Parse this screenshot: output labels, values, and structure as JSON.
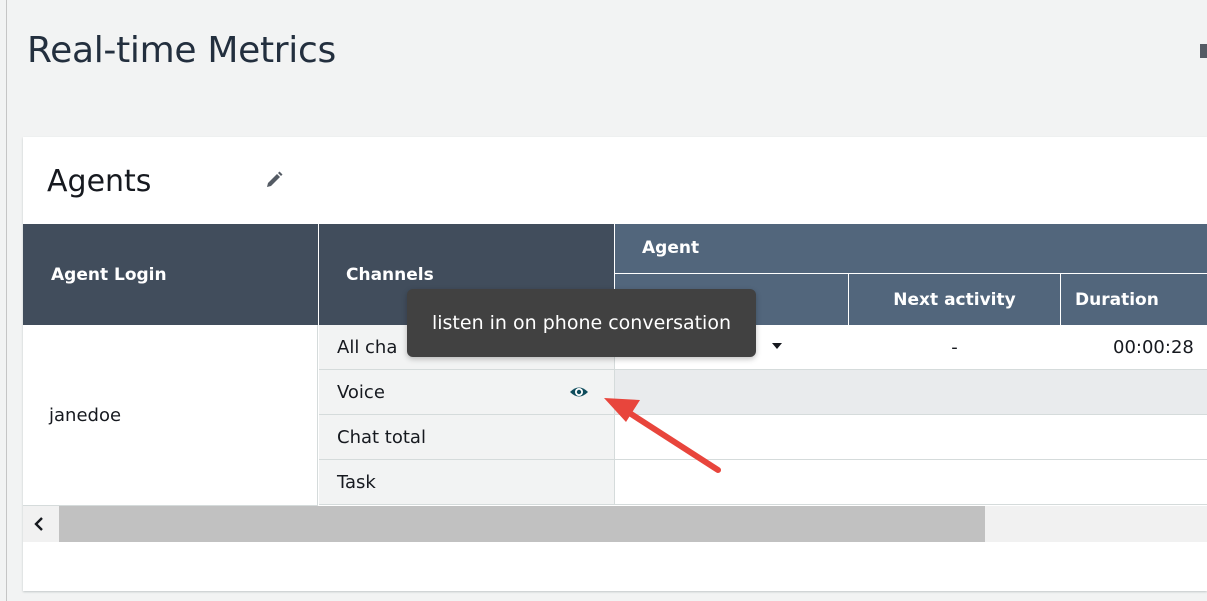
{
  "page": {
    "title": "Real-time Metrics"
  },
  "card": {
    "title": "Agents",
    "edit_icon": "pencil-icon"
  },
  "table": {
    "headers": {
      "agent_login": "Agent Login",
      "channels": "Channels",
      "agent_group": "Agent",
      "next_activity": "Next activity",
      "duration": "Duration"
    },
    "agent": "janedoe",
    "rows": [
      {
        "channel": "All cha",
        "next_activity": "-",
        "duration": "00:00:28"
      },
      {
        "channel": "Voice",
        "icon": "eye-icon"
      },
      {
        "channel": "Chat total"
      },
      {
        "channel": "Task"
      }
    ]
  },
  "tooltip": {
    "text": "listen in on phone conversation"
  },
  "colors": {
    "header_dark": "#414d5c",
    "header_mid": "#52667c",
    "eye_icon": "#0f4c5c",
    "arrow": "#e8453c"
  }
}
